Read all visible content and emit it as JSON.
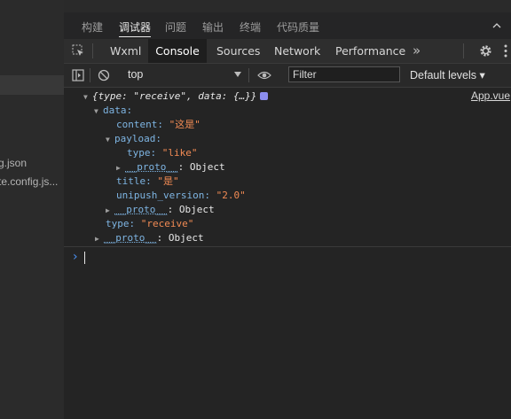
{
  "sidebar": {
    "files": [
      "g.json",
      "te.config.js..."
    ]
  },
  "bottom_tabs": [
    "构建",
    "调试器",
    "问题",
    "输出",
    "终端",
    "代码质量"
  ],
  "devtools_tabs": [
    "Wxml",
    "Console",
    "Sources",
    "Network",
    "Performance"
  ],
  "more_tabs": "»",
  "toolbar": {
    "context": "top",
    "filter_placeholder": "Filter",
    "levels": "Default levels ▾"
  },
  "console": {
    "header": "{type: \"receive\", data: {…}}",
    "source": "App.vue",
    "lines": {
      "data_key": "data:",
      "content_key": "content:",
      "content_val": "\"这是\"",
      "payload_key": "payload:",
      "type_key": "type:",
      "type_val": "\"like\"",
      "proto_key": "__proto__",
      "proto_val": ": Object",
      "title_key": "title:",
      "title_val": "\"是\"",
      "unipush_key": "unipush_version:",
      "unipush_val": "\"2.0\"",
      "type2_key": "type:",
      "type2_val": "\"receive\""
    }
  }
}
